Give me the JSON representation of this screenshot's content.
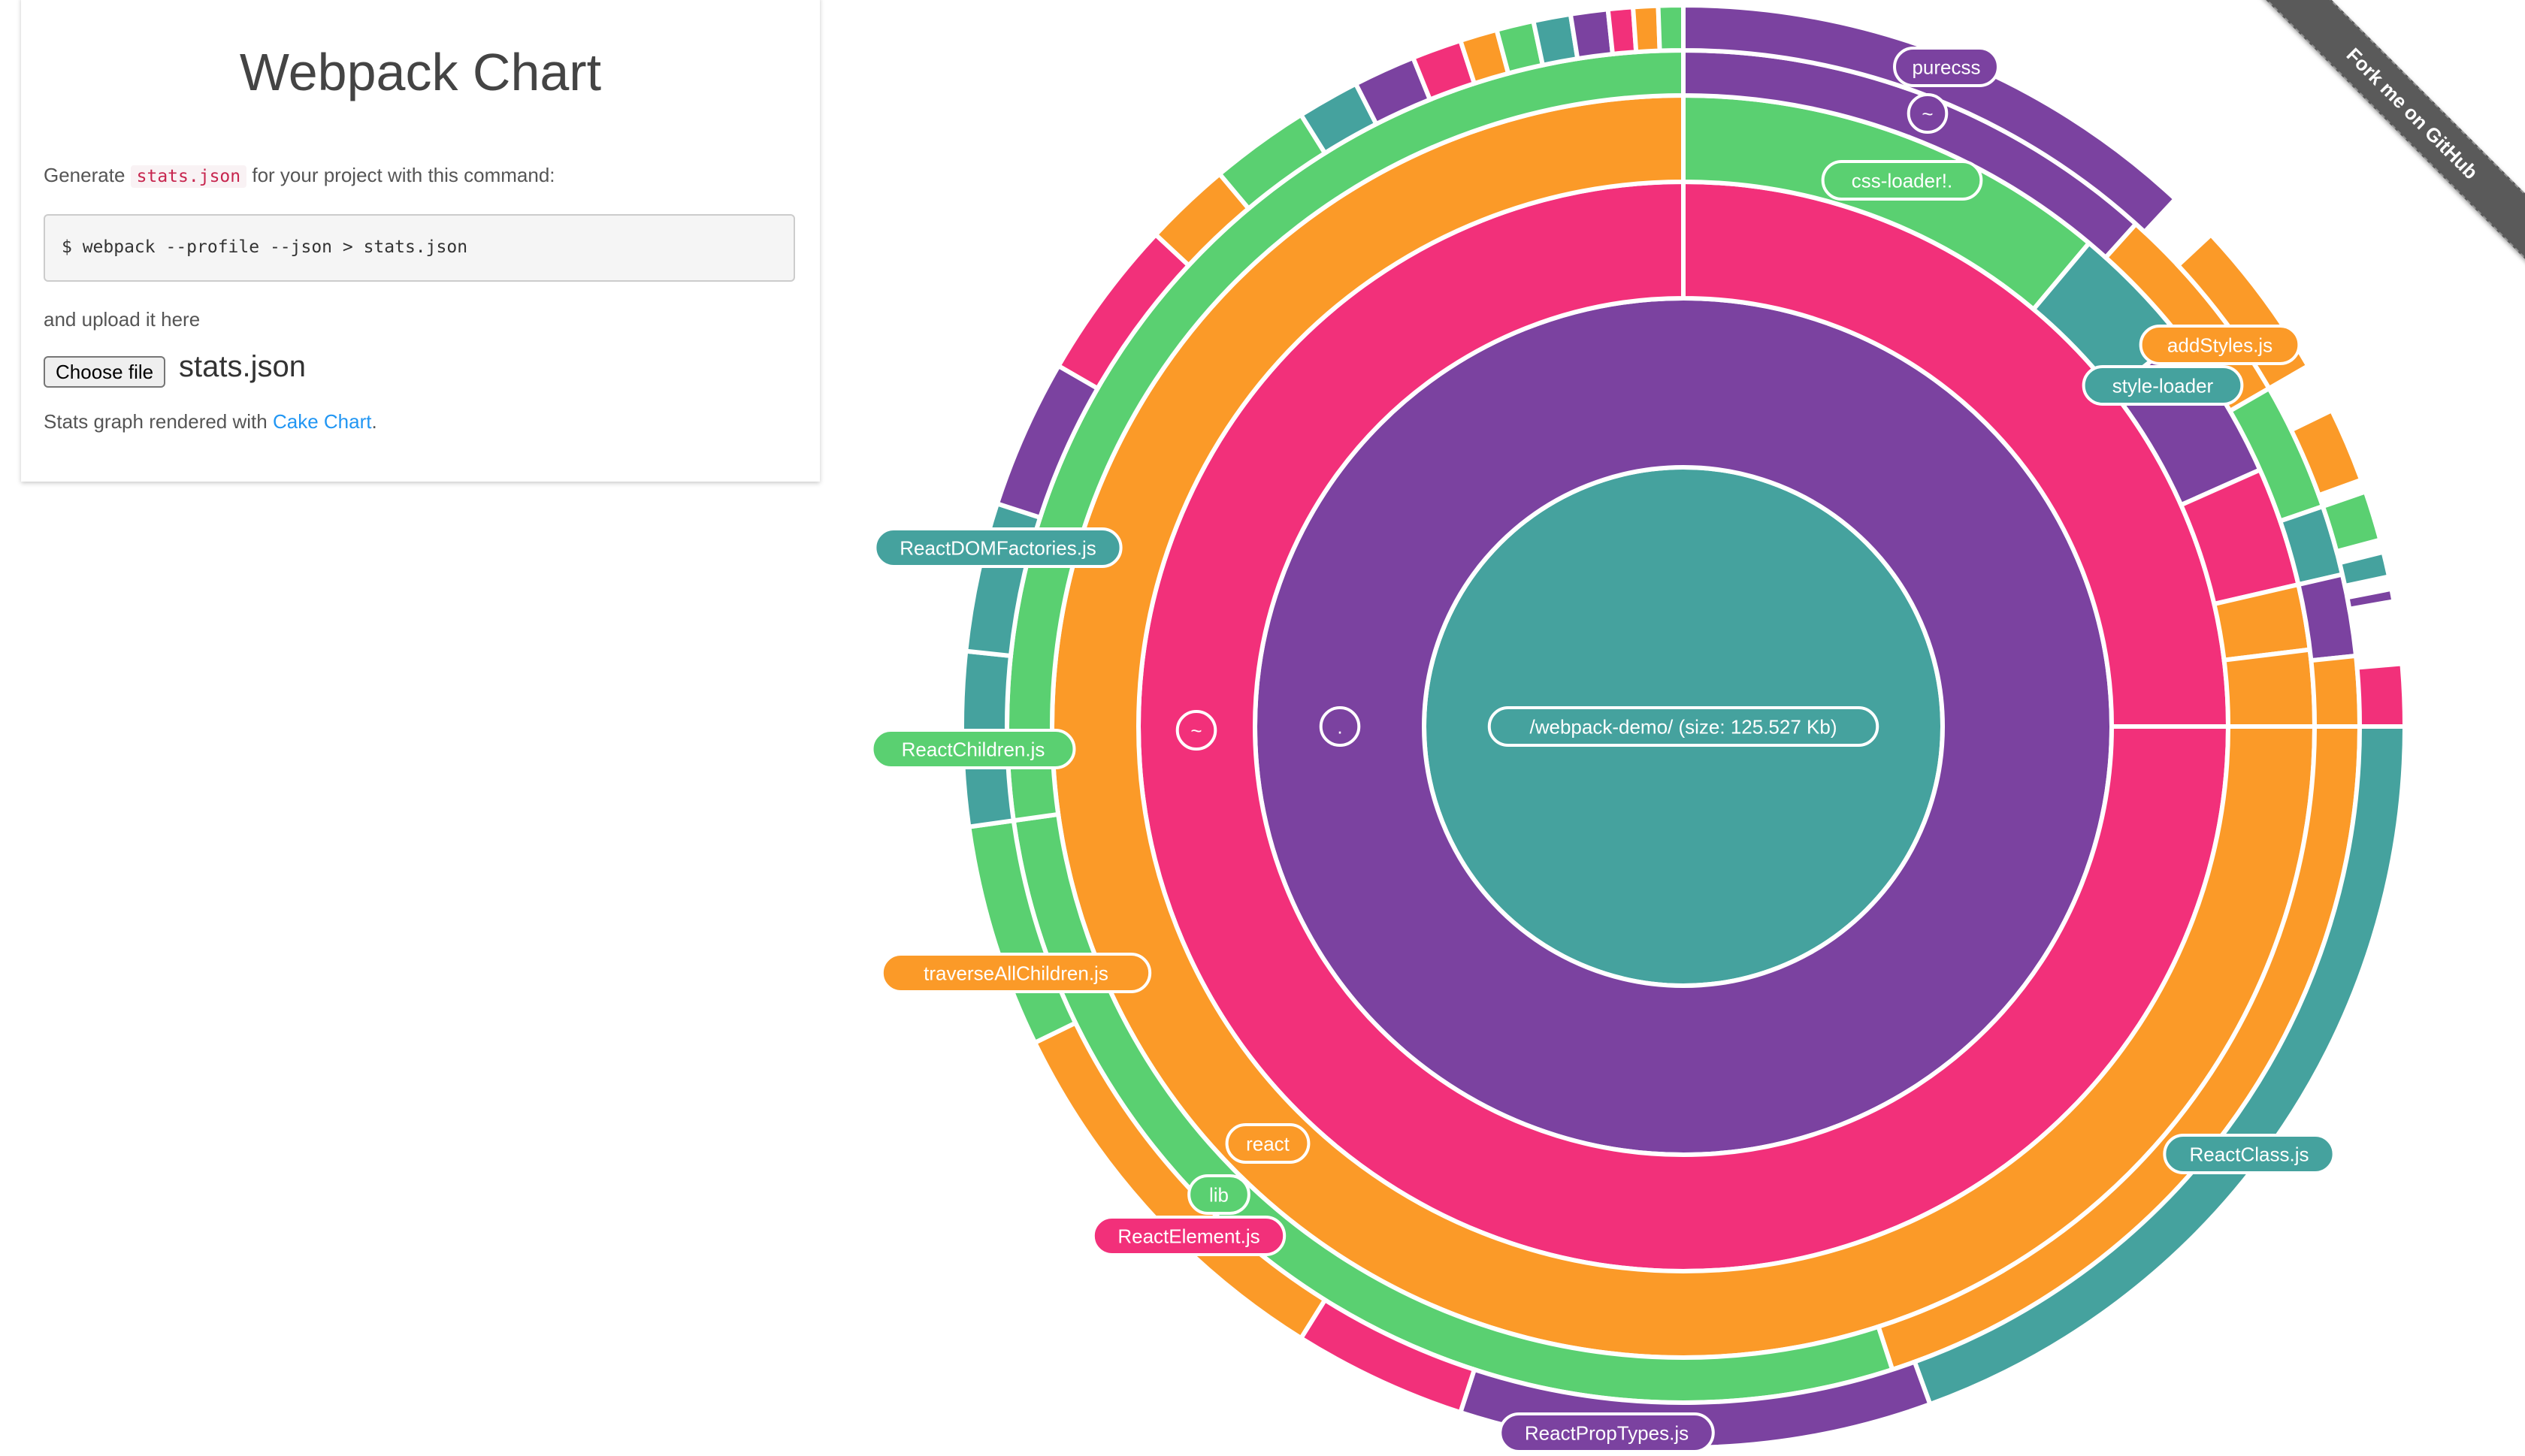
{
  "panel": {
    "title": "Webpack Chart",
    "generate_prefix": "Generate ",
    "generate_code": "stats.json",
    "generate_suffix": " for your project with this command:",
    "command": "$ webpack --profile --json > stats.json",
    "upload_text": "and upload it here",
    "choose_file_label": "Choose file",
    "file_name": "stats.json",
    "credit_prefix": "Stats graph rendered with ",
    "credit_link": "Cake Chart",
    "credit_suffix": "."
  },
  "ribbon": {
    "label": "Fork me on GitHub"
  },
  "chart_data": {
    "type": "sunburst",
    "colors": {
      "teal": "#45a29e",
      "purple": "#7b42a0",
      "pink": "#f2307a",
      "orange": "#fb9a28",
      "green": "#5ad071"
    },
    "center_label": "/webpack-demo/ (size: 125.527 Kb)",
    "labels": [
      {
        "text": "/webpack-demo/ (size: 125.527 Kb)",
        "color": "#45a29e"
      },
      {
        "text": ".",
        "color": "#7b42a0"
      },
      {
        "text": "~",
        "color": "#f2307a"
      },
      {
        "text": "react",
        "color": "#fb9a28"
      },
      {
        "text": "lib",
        "color": "#5ad071"
      },
      {
        "text": "ReactElement.js",
        "color": "#f2307a"
      },
      {
        "text": "ReactDOMFactories.js",
        "color": "#45a29e"
      },
      {
        "text": "ReactChildren.js",
        "color": "#5ad071"
      },
      {
        "text": "traverseAllChildren.js",
        "color": "#fb9a28"
      },
      {
        "text": "ReactPropTypes.js",
        "color": "#7b42a0"
      },
      {
        "text": "ReactClass.js",
        "color": "#45a29e"
      },
      {
        "text": "purecss",
        "color": "#7b42a0"
      },
      {
        "text": "~",
        "color": "#7b42a0"
      },
      {
        "text": "css-loader!.",
        "color": "#5ad071"
      },
      {
        "text": "addStyles.js",
        "color": "#fb9a28"
      },
      {
        "text": "style-loader",
        "color": "#45a29e"
      }
    ]
  }
}
